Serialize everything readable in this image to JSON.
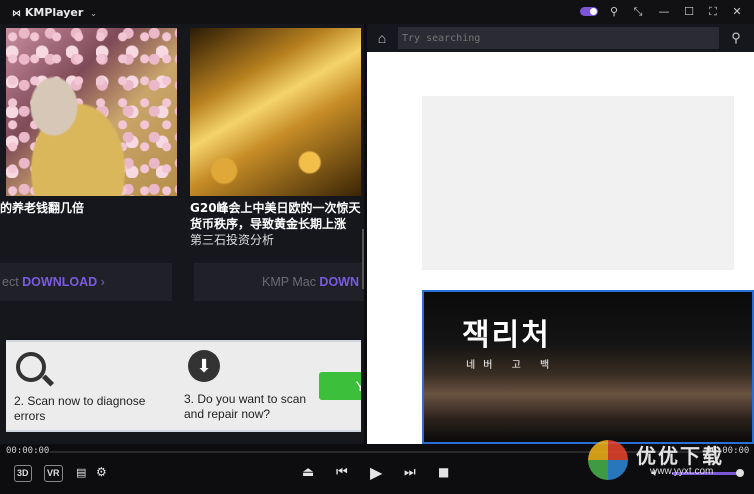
{
  "app": {
    "title": "KMPlayer"
  },
  "left": {
    "news": [
      {
        "caption": "你的养老钱翻几倍",
        "subcaption": ""
      },
      {
        "caption": "G20峰会上中美日欧的一次惊天\n货币秩序，导致黄金长期上涨",
        "subcaption": "第三石投资分析"
      }
    ],
    "downloads": [
      {
        "prefix": "ect ",
        "highlight": "DOWNLOAD",
        "suffix": "  ›"
      },
      {
        "prefix": "KMP Mac ",
        "highlight": "DOWN",
        "suffix": ""
      }
    ],
    "ad": {
      "step2": "2. Scan now to diagnose\nerrors",
      "step3": "3. Do you want to scan\nand repair now?",
      "button": "Y"
    }
  },
  "right": {
    "search": {
      "placeholder": "Try searching"
    },
    "movie": {
      "title": "잭리처",
      "subtitle": "네버 고 백"
    }
  },
  "player": {
    "time_current": "00:00:00",
    "time_total": "00:00:00",
    "badges": [
      "3D",
      "VR"
    ],
    "volume": 0.9
  },
  "watermark": {
    "brand": "优优下载",
    "url": "www.yyxt.com"
  },
  "colors": {
    "accent": "#7b57d8",
    "download_highlight": "#7a5ce0",
    "frame_blue": "#2b6fd6"
  }
}
